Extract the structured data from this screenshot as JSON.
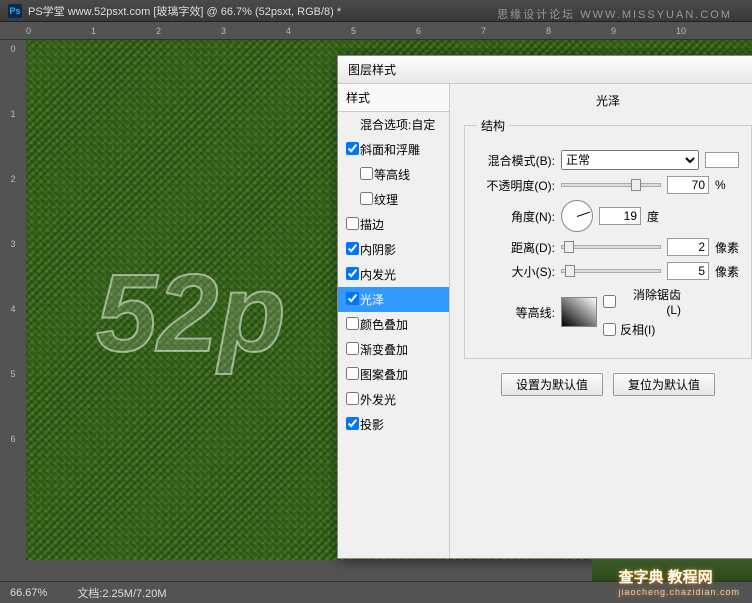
{
  "titlebar": {
    "app": "Ps",
    "doc": "PS学堂  www.52psxt.com [玻璃字效] @ 66.7% (52psxt, RGB/8) *"
  },
  "watermark_top": "思缘设计论坛 WWW.MISSYUAN.COM",
  "ruler_h": [
    "0",
    "1",
    "2",
    "3",
    "4",
    "5",
    "6",
    "7",
    "8",
    "9",
    "10"
  ],
  "ruler_v": [
    "0",
    "1",
    "2",
    "3",
    "4",
    "5",
    "6"
  ],
  "canvas_text": "52p",
  "dialog": {
    "title": "图层样式",
    "styles_header": "样式",
    "items": [
      {
        "label": "混合选项:自定",
        "checked": null
      },
      {
        "label": "斜面和浮雕",
        "checked": true
      },
      {
        "label": "等高线",
        "checked": false,
        "sub": true
      },
      {
        "label": "纹理",
        "checked": false,
        "sub": true
      },
      {
        "label": "描边",
        "checked": false
      },
      {
        "label": "内阴影",
        "checked": true
      },
      {
        "label": "内发光",
        "checked": true
      },
      {
        "label": "光泽",
        "checked": true,
        "sel": true
      },
      {
        "label": "颜色叠加",
        "checked": false
      },
      {
        "label": "渐变叠加",
        "checked": false
      },
      {
        "label": "图案叠加",
        "checked": false
      },
      {
        "label": "外发光",
        "checked": false
      },
      {
        "label": "投影",
        "checked": true
      }
    ],
    "panel_title": "光泽",
    "group_title": "结构",
    "blend_label": "混合模式(B):",
    "blend_value": "正常",
    "opacity_label": "不透明度(O):",
    "opacity_value": "70",
    "opacity_unit": "%",
    "angle_label": "角度(N):",
    "angle_value": "19",
    "angle_unit": "度",
    "distance_label": "距离(D):",
    "distance_value": "2",
    "distance_unit": "像素",
    "size_label": "大小(S):",
    "size_value": "5",
    "size_unit": "像素",
    "contour_label": "等高线:",
    "antialias_label": "消除锯齿(L)",
    "invert_label": "反相(I)",
    "btn_default": "设置为默认值",
    "btn_reset": "复位为默认值"
  },
  "status": {
    "zoom": "66.67%",
    "doc": "文档:2.25M/7.20M"
  },
  "watermark_br": {
    "big": "查字典 教程网",
    "small": "jiaocheng.chazidian.com"
  }
}
